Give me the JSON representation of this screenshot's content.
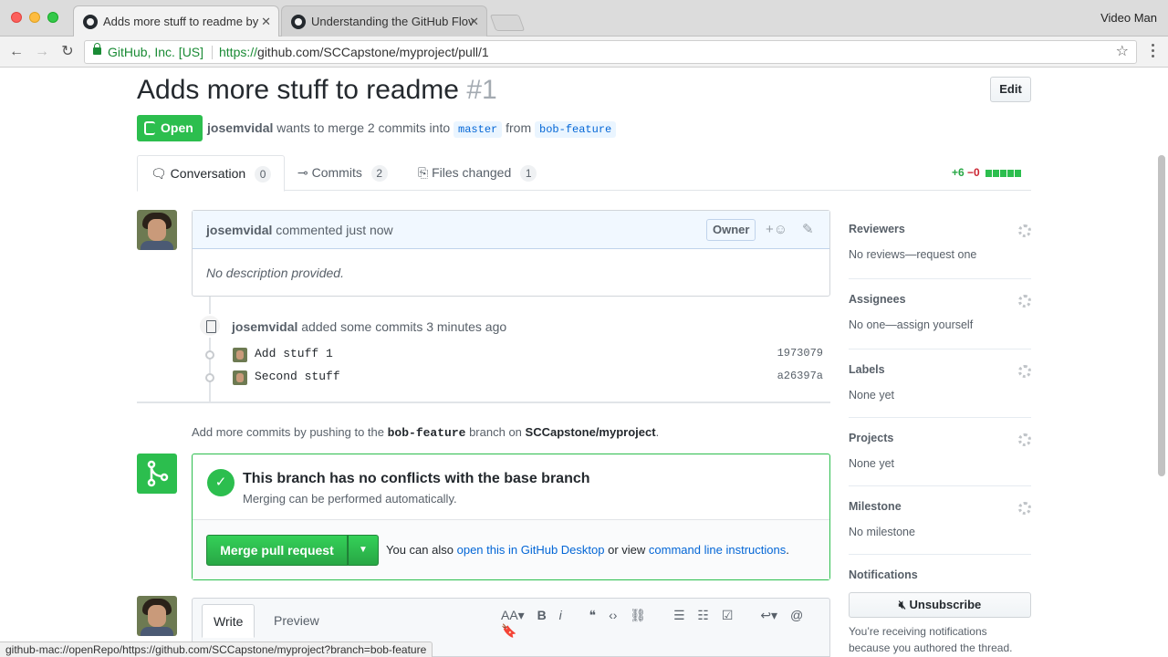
{
  "browser": {
    "tabs": [
      {
        "title": "Adds more stuff to readme by",
        "active": true
      },
      {
        "title": "Understanding the GitHub Flov",
        "active": false
      }
    ],
    "profile": "Video Man",
    "secure_label": "GitHub, Inc. [US]",
    "url_proto": "https://",
    "url_rest": "github.com/SCCapstone/myproject/pull/1",
    "close_glyph": "✕"
  },
  "pr": {
    "title": "Adds more stuff to readme",
    "number": "#1",
    "edit_label": "Edit",
    "state": "Open",
    "author": "josemvidal",
    "meta_mid": "wants to merge 2 commits into",
    "base_branch": "master",
    "meta_from": "from",
    "head_branch": "bob-feature"
  },
  "tabs": [
    {
      "label": "Conversation",
      "count": "0",
      "icon": "comment-discussion-icon"
    },
    {
      "label": "Commits",
      "count": "2",
      "icon": "git-commit-icon"
    },
    {
      "label": "Files changed",
      "count": "1",
      "icon": "file-diff-icon"
    }
  ],
  "diffstat": {
    "additions": "+6",
    "deletions": "−0",
    "bar_blocks": 5
  },
  "comment": {
    "author": "josemvidal",
    "action": "commented just now",
    "badge": "Owner",
    "react": "+☺",
    "edit_glyph": "✎",
    "body": "No description provided."
  },
  "commits_event": {
    "author": "josemvidal",
    "action": "added some commits 3 minutes ago",
    "commits": [
      {
        "message": "Add stuff 1",
        "sha": "1973079"
      },
      {
        "message": "Second stuff",
        "sha": "a26397a"
      }
    ]
  },
  "push_hint": {
    "pre": "Add more commits by pushing to the",
    "branch": "bob-feature",
    "mid": "branch on",
    "repo": "SCCapstone/myproject",
    "end": "."
  },
  "merge": {
    "title": "This branch has no conflicts with the base branch",
    "subtitle": "Merging can be performed automatically.",
    "button": "Merge pull request",
    "note_pre": "You can also",
    "link_desktop": "open this in GitHub Desktop",
    "note_mid": "or view",
    "link_cli": "command line instructions",
    "note_end": "."
  },
  "editor": {
    "tab_write": "Write",
    "tab_preview": "Preview",
    "tools": [
      "AA▾",
      "B",
      "i",
      "❝",
      "‹›",
      "⛓",
      "☰",
      "☷",
      "☑",
      "↩▾",
      "@",
      "🔖"
    ]
  },
  "sidebar": {
    "reviewers": {
      "label": "Reviewers",
      "value": "No reviews—request one"
    },
    "assignees": {
      "label": "Assignees",
      "value": "No one—assign yourself"
    },
    "labels": {
      "label": "Labels",
      "value": "None yet"
    },
    "projects": {
      "label": "Projects",
      "value": "None yet"
    },
    "milestone": {
      "label": "Milestone",
      "value": "No milestone"
    },
    "notifications": {
      "label": "Notifications",
      "button": "Unsubscribe",
      "text": "You’re receiving notifications because you authored the thread."
    }
  },
  "status_bar": "github-mac://openRepo/https://github.com/SCCapstone/myproject?branch=bob-feature",
  "colors": {
    "accent_green": "#2cbe4e",
    "link_blue": "#0366d6",
    "branch_bg": "#eaf5ff"
  }
}
